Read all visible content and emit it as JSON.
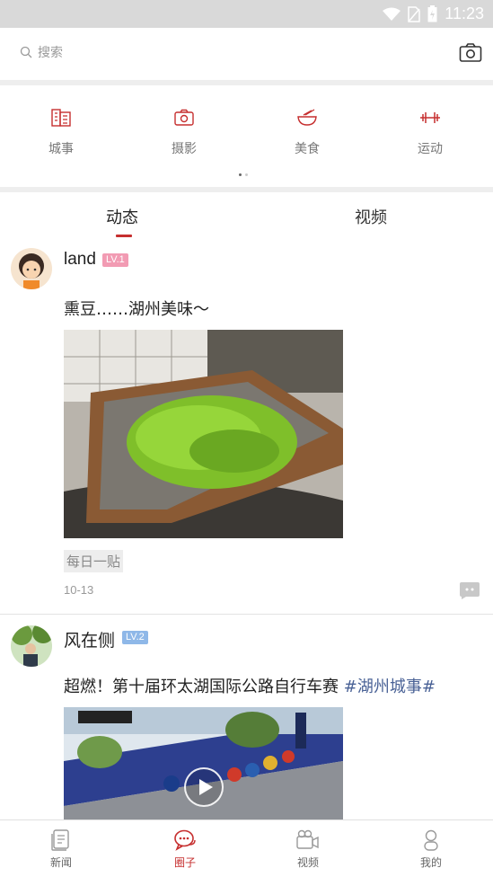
{
  "status_bar": {
    "time": "11:23"
  },
  "search": {
    "placeholder": "搜索"
  },
  "categories": [
    {
      "label": "城事",
      "icon": "buildings-icon"
    },
    {
      "label": "摄影",
      "icon": "camera-icon"
    },
    {
      "label": "美食",
      "icon": "bowl-icon"
    },
    {
      "label": "运动",
      "icon": "dumbbell-icon"
    }
  ],
  "tabs": [
    {
      "label": "动态",
      "active": true
    },
    {
      "label": "视频",
      "active": false
    }
  ],
  "posts": [
    {
      "username": "land",
      "level": "LV.1",
      "level_color": "#f29bb3",
      "text": "熏豆……湖州美味～",
      "tag": "每日一贴",
      "date": "10-13"
    },
    {
      "username": "风在侧",
      "level": "LV.2",
      "level_color": "#8fb8e8",
      "text": "超燃！第十届环太湖国际公路自行车赛 ",
      "topic": "#湖州城事#"
    }
  ],
  "bottom_nav": [
    {
      "label": "新闻",
      "icon": "news-icon",
      "active": false
    },
    {
      "label": "圈子",
      "icon": "chat-circle-icon",
      "active": true
    },
    {
      "label": "视频",
      "icon": "video-camera-icon",
      "active": false
    },
    {
      "label": "我的",
      "icon": "person-icon",
      "active": false
    }
  ],
  "colors": {
    "accent": "#c62f2f",
    "topic": "#4a6296",
    "divider": "#eeeeee"
  }
}
